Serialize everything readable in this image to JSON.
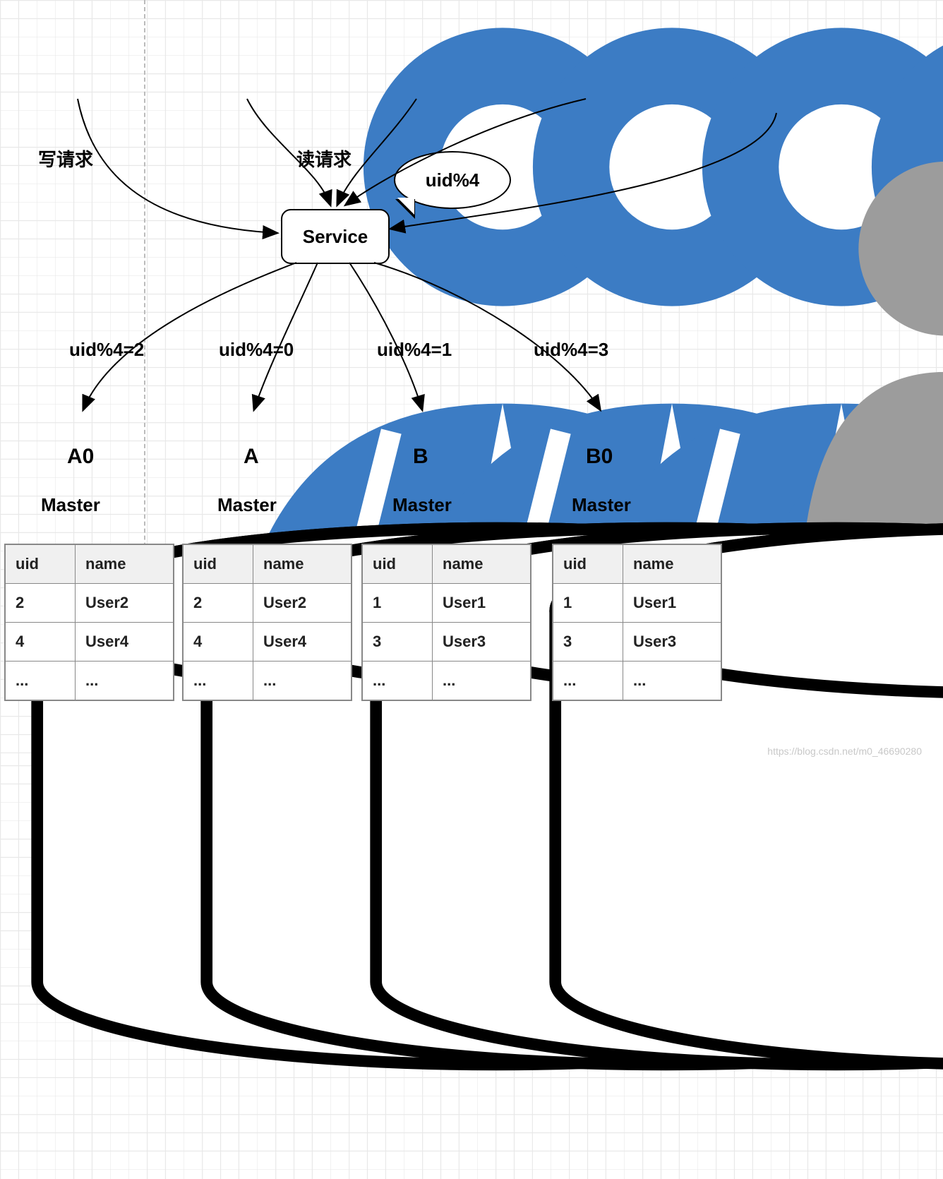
{
  "labels": {
    "write_request": "写请求",
    "read_request": "读请求",
    "service": "Service",
    "bubble": "uid%4",
    "branches": [
      "uid%4=2",
      "uid%4=0",
      "uid%4=1",
      "uid%4=3"
    ]
  },
  "databases": [
    {
      "name": "A0",
      "role": "Master"
    },
    {
      "name": "A",
      "role": "Master"
    },
    {
      "name": "B",
      "role": "Master"
    },
    {
      "name": "B0",
      "role": "Master"
    }
  ],
  "tables": {
    "headers": {
      "uid": "uid",
      "name": "name"
    },
    "sets": [
      {
        "rows": [
          [
            "2",
            "User2"
          ],
          [
            "4",
            "User4"
          ],
          [
            "...",
            "..."
          ]
        ]
      },
      {
        "rows": [
          [
            "2",
            "User2"
          ],
          [
            "4",
            "User4"
          ],
          [
            "...",
            "..."
          ]
        ]
      },
      {
        "rows": [
          [
            "1",
            "User1"
          ],
          [
            "3",
            "User3"
          ],
          [
            "...",
            "..."
          ]
        ]
      },
      {
        "rows": [
          [
            "1",
            "User1"
          ],
          [
            "3",
            "User3"
          ],
          [
            "...",
            "..."
          ]
        ]
      }
    ]
  },
  "watermark": "https://blog.csdn.net/m0_46690280"
}
